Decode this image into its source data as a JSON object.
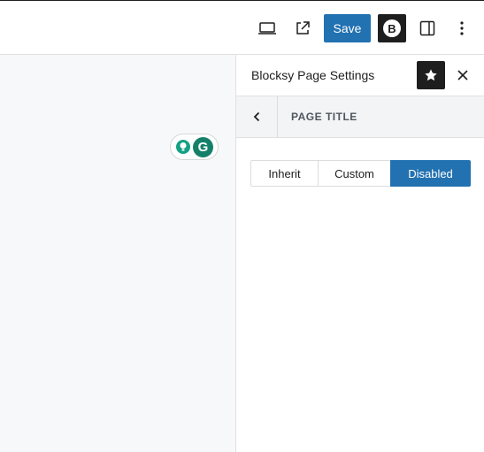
{
  "toolbar": {
    "preview_icon": "desktop-icon",
    "view_post_icon": "external-link-icon",
    "save_label": "Save",
    "blocksy_logo_text": "B",
    "settings_icon": "sidebar-panel-icon",
    "options_icon": "more-vertical-icon"
  },
  "panel": {
    "title": "Blocksy Page Settings",
    "pin_icon": "star-icon",
    "close_icon": "close-icon",
    "back_icon": "chevron-left-icon",
    "section_title": "PAGE TITLE",
    "options": [
      {
        "label": "Inherit",
        "selected": false
      },
      {
        "label": "Custom",
        "selected": false
      },
      {
        "label": "Disabled",
        "selected": true
      }
    ]
  },
  "grammarly": {
    "logo_text": "G"
  },
  "colors": {
    "accent": "#2271b1",
    "dark": "#1e1e1e",
    "canvas": "#f7f8fa",
    "grammarly": "#15806a"
  }
}
